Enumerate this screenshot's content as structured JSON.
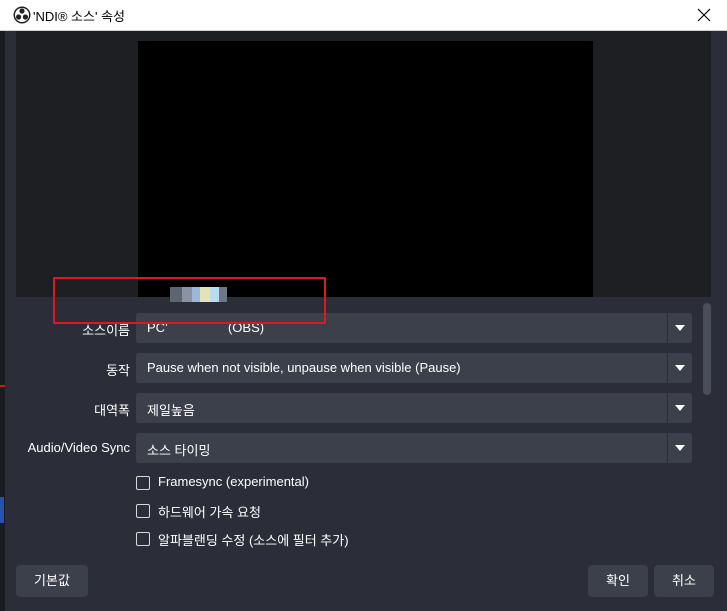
{
  "window": {
    "title": "'NDI® 소스' 속성",
    "icon": "obs-logo-icon"
  },
  "fields": {
    "source_name": {
      "label": "소스이름",
      "value": "PC’ (OBS)"
    },
    "behavior": {
      "label": "동작",
      "value": "Pause when not visible, unpause when visible (Pause)"
    },
    "bandwidth": {
      "label": "대역폭",
      "value": "제일높음"
    },
    "av_sync": {
      "label": "Audio/Video Sync",
      "value": "소스 타이밍"
    }
  },
  "checkboxes": [
    {
      "label": "Framesync (experimental)",
      "checked": false
    },
    {
      "label": "하드웨어 가속 요청",
      "checked": false
    },
    {
      "label": "알파블랜딩 수정 (소스에 필터 추가)",
      "checked": false
    }
  ],
  "buttons": {
    "defaults": "기본값",
    "ok": "확인",
    "cancel": "취소"
  },
  "colors": {
    "highlight": "#e0171c",
    "dialog_bg": "#2b2e38",
    "control_bg": "#3c404b"
  }
}
